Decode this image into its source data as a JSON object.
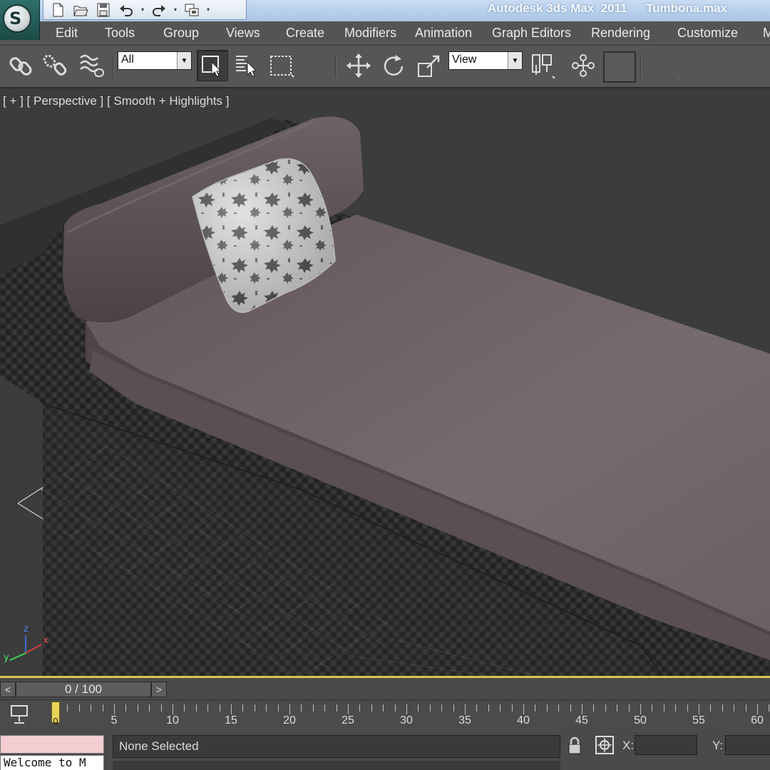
{
  "titlebar": {
    "app_title": "Autodesk 3ds Max  2011",
    "file_name": "Tumbona.max"
  },
  "menu": [
    "Edit",
    "Tools",
    "Group",
    "Views",
    "Create",
    "Modifiers",
    "Animation",
    "Graph Editors",
    "Rendering",
    "Customize",
    "M"
  ],
  "toolbar": {
    "selection_filter": "All",
    "reference_coordinate_system": "View"
  },
  "viewport": {
    "label": "[ + ] [ Perspective ] [ Smooth + Highlights ]",
    "axis_labels": {
      "x": "x",
      "y": "y",
      "z": "z"
    }
  },
  "time_slider": {
    "position": "0 / 100",
    "prev": "<",
    "next": ">"
  },
  "trackbar": {
    "current_frame": "0",
    "labels": [
      "5",
      "10",
      "15",
      "20",
      "25",
      "30",
      "35",
      "40",
      "45",
      "50",
      "55",
      "60"
    ]
  },
  "status": {
    "selection": "None Selected",
    "script_listener_text": "Welcome to M",
    "x_label": "X:",
    "y_label": "Y:"
  },
  "colors": {
    "title_bar": "#b7cfea",
    "viewport_bg": "#3c3c3c",
    "active_viewport_border": "#d8c44b",
    "mattress": "#6f6266",
    "wicker": "#2a2a2c",
    "script_listener": "#f2cdd1"
  },
  "icons": {
    "logo": "3ds-max-logo-icon",
    "quick_access": [
      "new-file-icon",
      "open-folder-icon",
      "save-icon",
      "undo-icon",
      "redo-icon",
      "project-folder-icon"
    ],
    "toolbar": [
      "select-and-link-icon",
      "unlink-selection-icon",
      "bind-to-space-warp-icon",
      "select-object-icon",
      "select-by-name-icon",
      "rectangular-selection-region-icon",
      "select-and-move-icon",
      "select-and-rotate-icon",
      "select-and-scale-icon",
      "use-pivot-point-center-icon",
      "select-and-manipulate-icon"
    ]
  }
}
